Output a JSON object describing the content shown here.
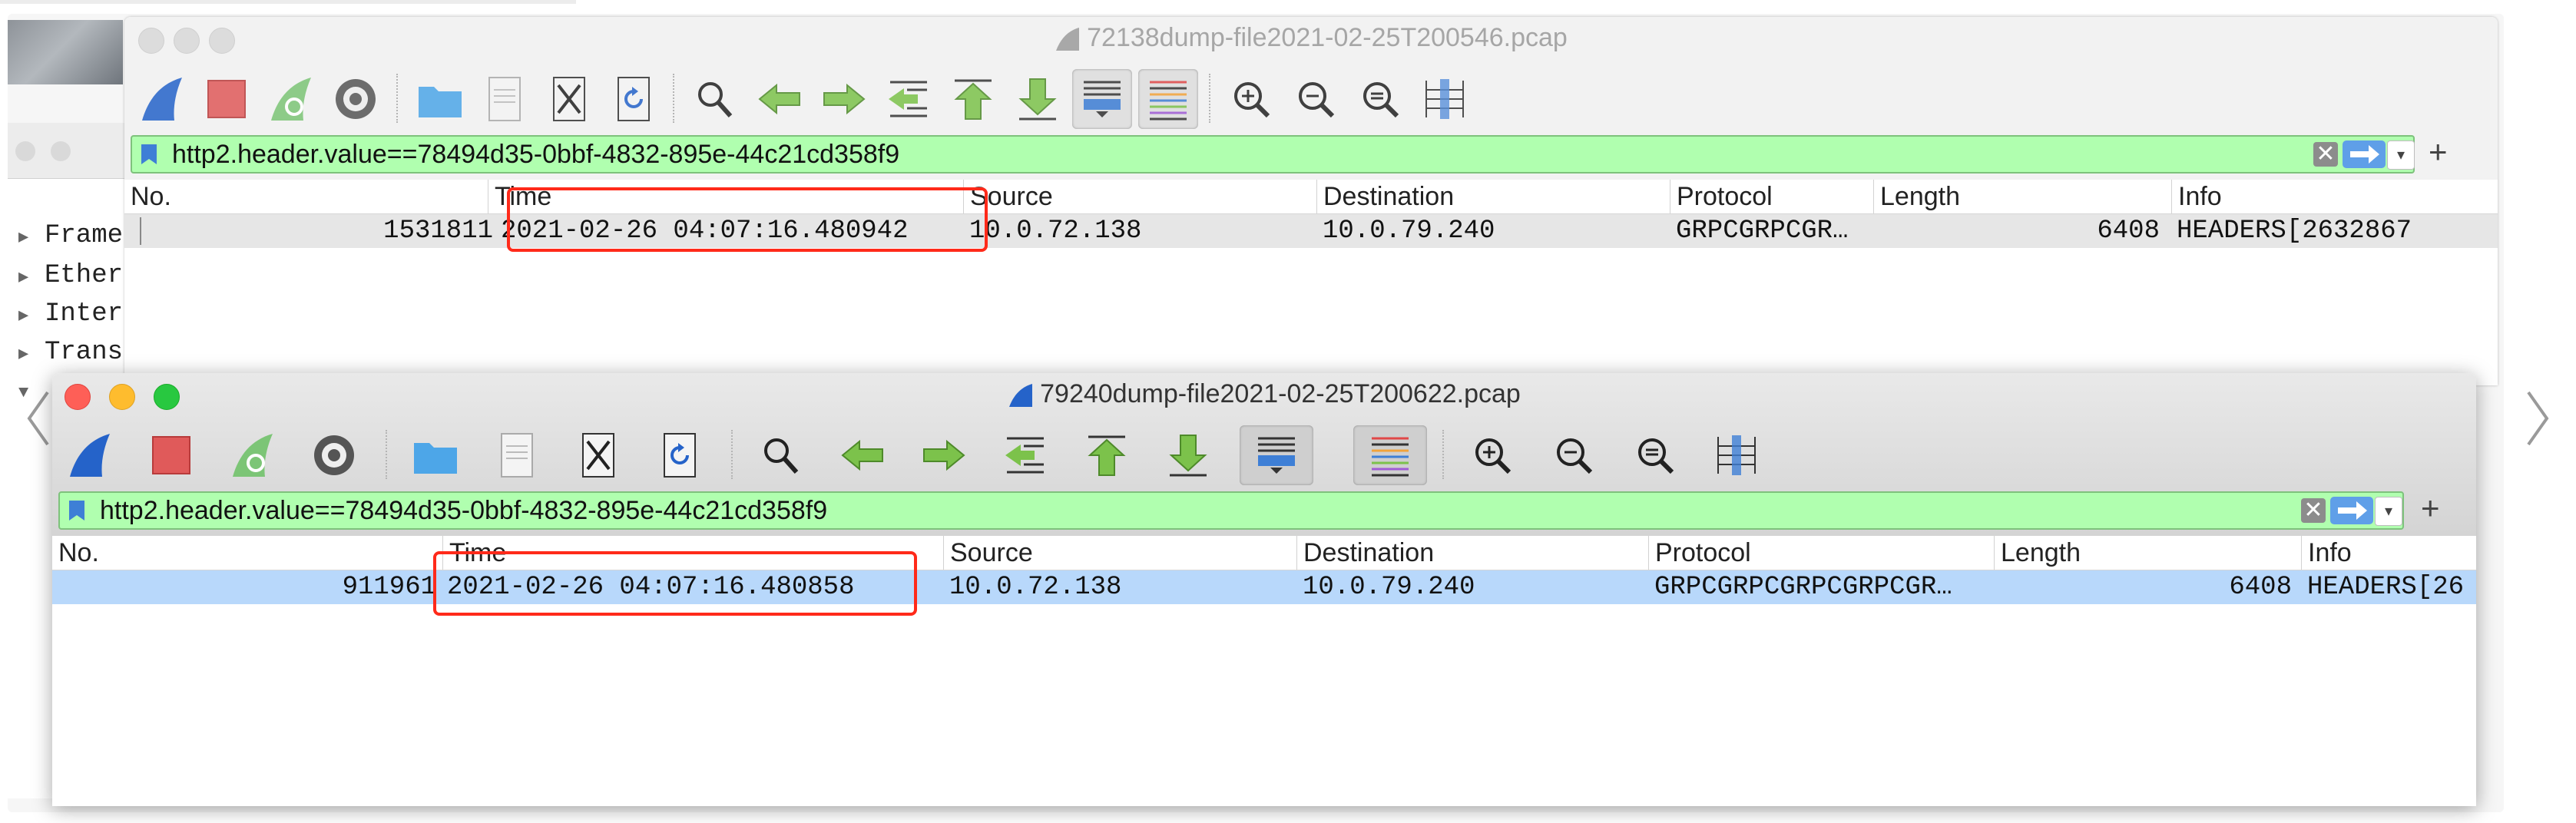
{
  "background": {
    "left_tree": [
      "Frame",
      "Ether",
      "Inter",
      "Trans"
    ]
  },
  "windows": [
    {
      "title": "72138dump-file2021-02-25T200546.pcap",
      "filter": "http2.header.value==78494d35-0bbf-4832-895e-44c21cd358f9",
      "columns": [
        "No.",
        "Time",
        "Source",
        "Destination",
        "Protocol",
        "Length",
        "Info"
      ],
      "row": {
        "no": "1531811",
        "time": "2021-02-26 04:07:16.480942",
        "source": "10.0.72.138",
        "destination": "10.0.79.240",
        "protocol": "GRPCGRPCGR…",
        "length": "6408",
        "info": "HEADERS[2632867"
      }
    },
    {
      "title": "79240dump-file2021-02-25T200622.pcap",
      "filter": "http2.header.value==78494d35-0bbf-4832-895e-44c21cd358f9",
      "columns": [
        "No.",
        "Time",
        "Source",
        "Destination",
        "Protocol",
        "Length",
        "Info"
      ],
      "row": {
        "no": "911961",
        "time": "2021-02-26 04:07:16.480858",
        "source": "10.0.72.138",
        "destination": "10.0.79.240",
        "protocol": "GRPCGRPCGRPCGRPCGR…",
        "length": "6408",
        "info": "HEADERS[26"
      }
    }
  ],
  "icons": [
    "shark-fin-start-icon",
    "stop-capture-icon",
    "restart-capture-icon",
    "capture-options-icon",
    "open-file-icon",
    "save-file-icon",
    "close-file-icon",
    "reload-file-icon",
    "find-packet-icon",
    "go-back-icon",
    "go-forward-icon",
    "go-to-packet-icon",
    "first-packet-icon",
    "last-packet-icon",
    "autoscroll-icon",
    "colorize-icon",
    "zoom-in-icon",
    "zoom-out-icon",
    "zoom-normal-icon",
    "resize-columns-icon",
    "filter-bookmark-icon",
    "clear-filter-icon",
    "apply-filter-icon",
    "carousel-prev-icon",
    "carousel-next-icon"
  ],
  "colors": {
    "filter_valid": "#b0ffaf",
    "selected_row": "#b8d8fb",
    "highlight_box": "#ff2a1a"
  }
}
